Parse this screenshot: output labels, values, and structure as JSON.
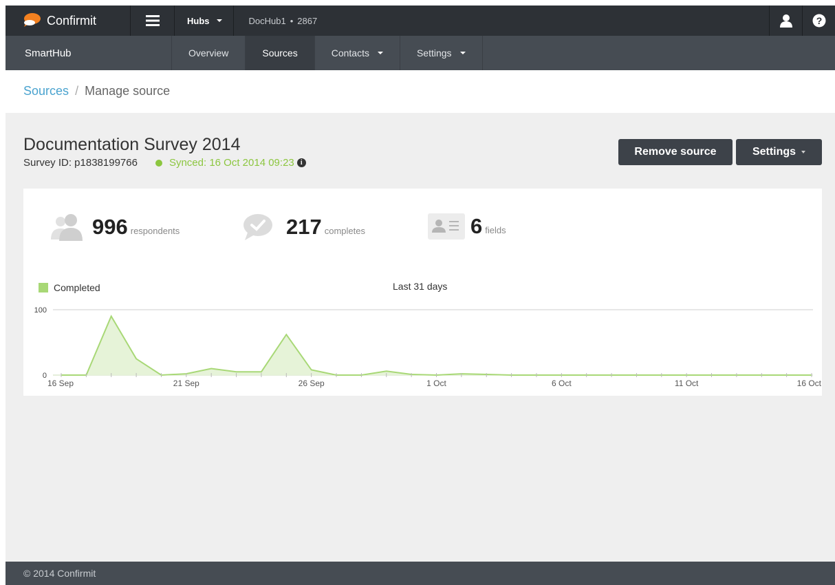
{
  "topbar": {
    "brand": "Confirmit",
    "hub_label": "Hubs",
    "hub_name": "DocHub1",
    "hub_sep": "•",
    "hub_id": "2867",
    "colors": {
      "bar": "#2d3136",
      "logo_accent": "#f48120"
    }
  },
  "nav": {
    "brand": "SmartHub",
    "items": [
      {
        "label": "Overview"
      },
      {
        "label": "Sources"
      },
      {
        "label": "Contacts"
      },
      {
        "label": "Settings"
      }
    ],
    "active": "Sources"
  },
  "breadcrumb": {
    "link": "Sources",
    "sep": "/",
    "current": "Manage source"
  },
  "source": {
    "title": "Documentation Survey 2014",
    "survey_id": "Survey ID: p1838199766",
    "sync_status": "Synced: 16 Oct 2014 09:23",
    "sync_color": "#8cc63f"
  },
  "actions": {
    "remove_label": "Remove source",
    "settings_label": "Settings"
  },
  "stats": {
    "respondents": {
      "value": "996",
      "label": "respondents",
      "icon": "people-icon"
    },
    "completes": {
      "value": "217",
      "label": "completes",
      "icon": "chat-check-icon"
    },
    "fields": {
      "value": "6",
      "label": "fields",
      "icon": "contact-card-icon"
    }
  },
  "chart_data": {
    "type": "area",
    "title": "Last 31 days",
    "legend": [
      "Completed"
    ],
    "series": [
      {
        "name": "Completed",
        "color": "#a8d876",
        "values": [
          0,
          0,
          90,
          25,
          0,
          2,
          10,
          5,
          5,
          62,
          8,
          0,
          0,
          6,
          1,
          0,
          2,
          1,
          0,
          0,
          0,
          0,
          0,
          0,
          0,
          0,
          0,
          0,
          0,
          0,
          0
        ]
      }
    ],
    "x_ticks": [
      "16 Sep",
      "21 Sep",
      "26 Sep",
      "1 Oct",
      "6 Oct",
      "11 Oct",
      "16 Oct"
    ],
    "y_ticks": [
      "0",
      "100"
    ],
    "ylim": [
      0,
      100
    ],
    "grid": true
  },
  "footer": {
    "text": "© 2014 Confirmit"
  }
}
